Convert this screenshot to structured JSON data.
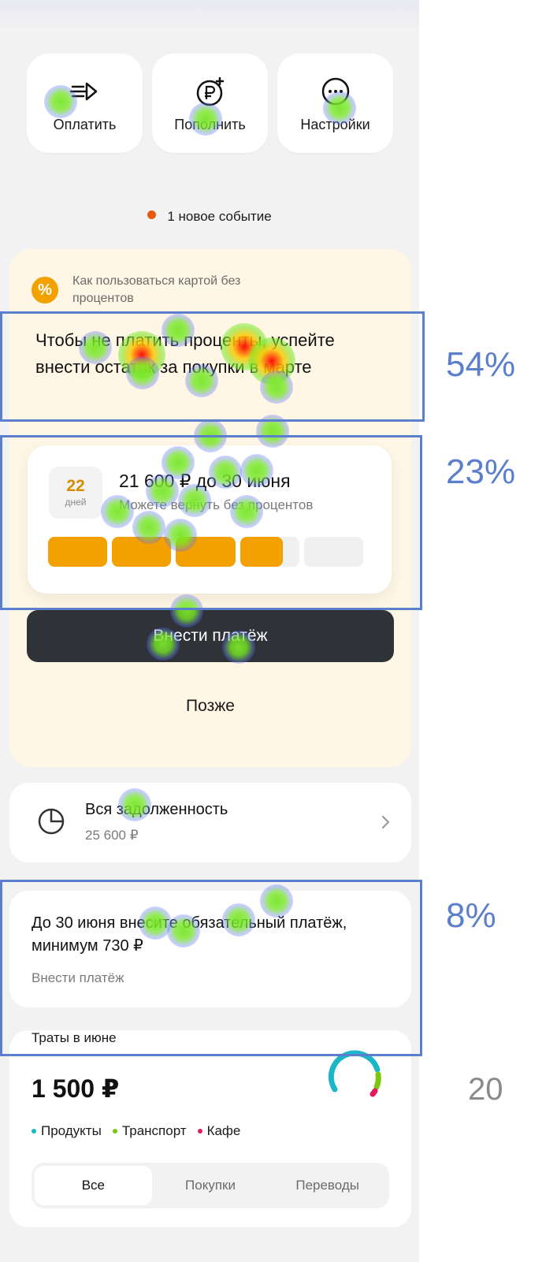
{
  "quick_actions": [
    {
      "label": "Оплатить",
      "icon": "arrow-out-icon"
    },
    {
      "label": "Пополнить",
      "icon": "ruble-plus-icon"
    },
    {
      "label": "Настройки",
      "icon": "more-icon"
    }
  ],
  "event": {
    "text": "1 новое событие",
    "dot_color": "#e8590c"
  },
  "promo": {
    "caption": "Как пользоваться картой без процентов",
    "message": "Чтобы не платить проценты, успейте внести остаток за покупки в марте",
    "days_number": "22",
    "days_unit": "дней",
    "amount_title": "21 600 ₽ до 30 июня",
    "amount_subtitle": "Можете вернуть без процентов",
    "progress_fractions": [
      1,
      1,
      1,
      0.72
    ],
    "accent_color": "#f2a100",
    "pay_button": "Внести платёж",
    "later_button": "Позже"
  },
  "total_debt": {
    "title": "Вся задолженность",
    "value": "25 600 ₽"
  },
  "minimum_payment": {
    "title": "До 30 июня внесите обязательный платёж, минимум 730 ₽",
    "link": "Внести платёж"
  },
  "spending": {
    "title": "Траты в июне",
    "amount": "1 500 ₽",
    "legend": [
      {
        "label": "Продукты",
        "color": "#1cb6c9"
      },
      {
        "label": "Транспорт",
        "color": "#7ac70c"
      },
      {
        "label": "Кафе",
        "color": "#e6195c"
      }
    ],
    "tabs": [
      "Все",
      "Покупки",
      "Переводы"
    ],
    "active_tab": "Все"
  },
  "heatmap_overlay": {
    "aoi_labels": [
      "54%",
      "23%",
      "8%"
    ],
    "side_number": "20",
    "box_color": "#5b7fcc"
  }
}
